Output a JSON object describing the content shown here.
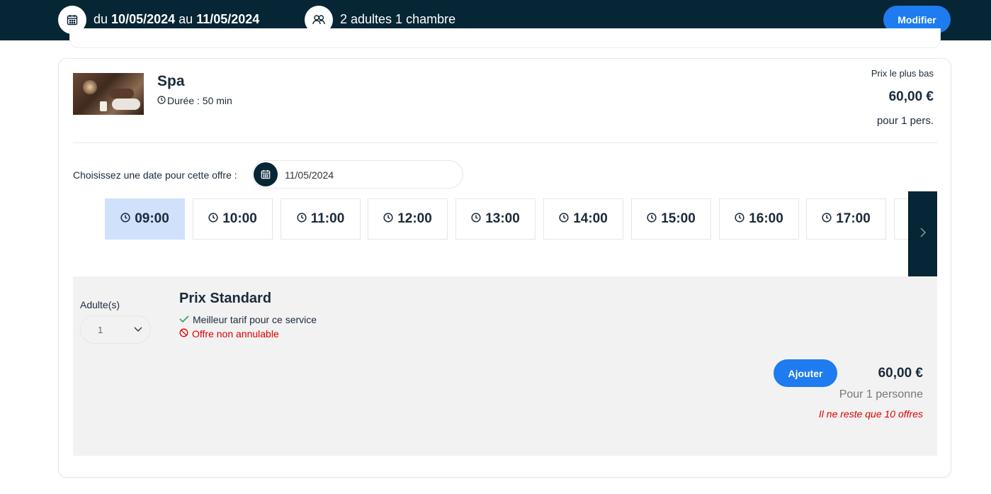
{
  "header": {
    "date_prefix": "du",
    "date_from": "10/05/2024",
    "date_connector": "au",
    "date_to": "11/05/2024",
    "guests": "2 adultes 1 chambre",
    "modify_label": "Modifier"
  },
  "service": {
    "title": "Spa",
    "duration": "Durée : 50 min",
    "lowest_price_label": "Prix le plus bas",
    "lowest_price": "60,00 €",
    "lowest_price_per": "pour 1 pers."
  },
  "date_selection": {
    "label": "Choisissez une date pour cette offre :",
    "value": "11/05/2024"
  },
  "time_slots": {
    "slots": [
      "09:00",
      "10:00",
      "11:00",
      "12:00",
      "13:00",
      "14:00",
      "15:00",
      "16:00",
      "17:00"
    ],
    "selected": "09:00"
  },
  "offer": {
    "adults_label": "Adulte(s)",
    "adults_value": "1",
    "title": "Prix Standard",
    "feature_good": "Meilleur tarif pour ce service",
    "feature_bad": "Offre non annulable",
    "add_label": "Ajouter",
    "price": "60,00 €",
    "price_per": "Pour 1 personne",
    "availability": "Il ne reste que 10 offres"
  },
  "colors": {
    "header_bg": "#062535",
    "accent": "#1e7bf0",
    "selected_slot": "#cfe1fb",
    "warning": "#e00000",
    "success": "#2aa05a"
  }
}
